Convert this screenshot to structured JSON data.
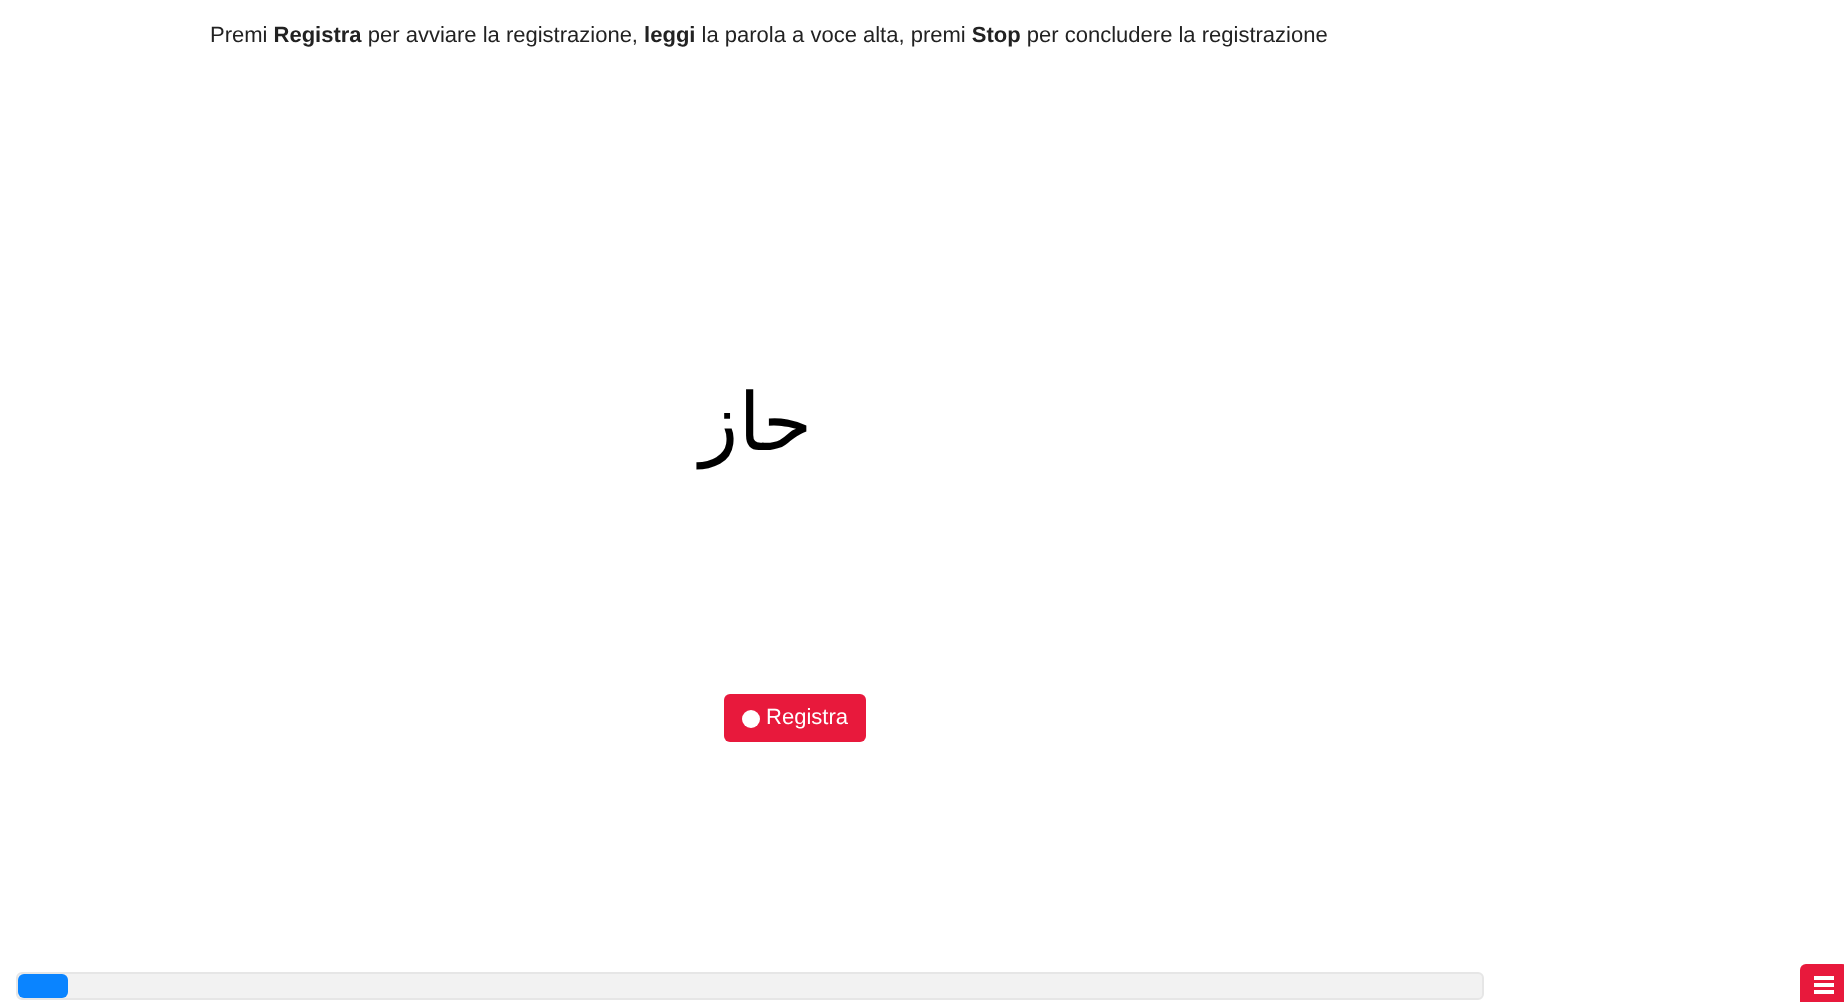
{
  "instruction": "Premi **Registra** per avviare la registrazione, **leggi** la parola a voce alta, premi **Stop** per concludere la registrazione",
  "word": "حاز",
  "record_button": {
    "label": "Registra"
  },
  "progress": {
    "level": 0.034
  }
}
